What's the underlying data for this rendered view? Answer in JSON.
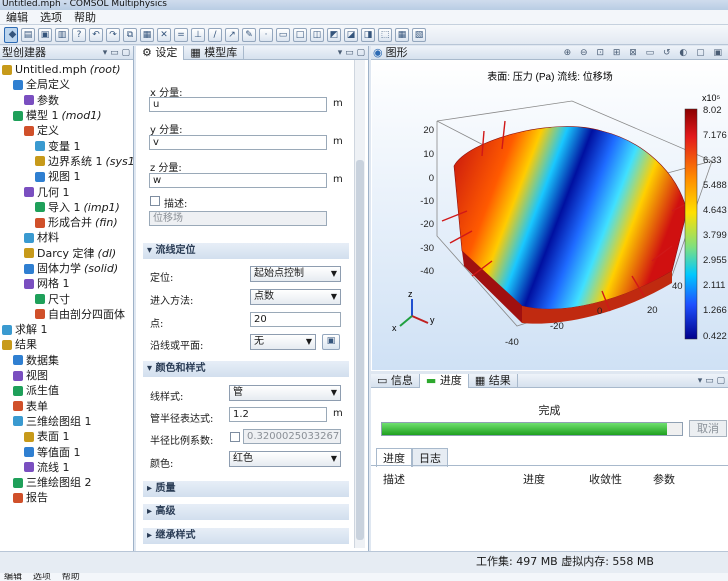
{
  "window": {
    "title": "Untitled.mph - COMSOL Multiphysics"
  },
  "menu": {
    "items": [
      "编辑",
      "选项",
      "帮助"
    ]
  },
  "model_builder": {
    "title": "型创建器",
    "tree": [
      {
        "label": "Untitled.mph",
        "suffix": "(root)",
        "indent": 0
      },
      {
        "label": "全局定义",
        "suffix": "",
        "indent": 1
      },
      {
        "label": "参数",
        "suffix": "",
        "indent": 2
      },
      {
        "label": "模型 1",
        "suffix": "(mod1)",
        "indent": 1
      },
      {
        "label": "定义",
        "suffix": "",
        "indent": 2
      },
      {
        "label": "变量 1",
        "suffix": "",
        "indent": 3
      },
      {
        "label": "边界系统 1",
        "suffix": "(sys1)",
        "indent": 3
      },
      {
        "label": "视图 1",
        "suffix": "",
        "indent": 3
      },
      {
        "label": "几何 1",
        "suffix": "",
        "indent": 2
      },
      {
        "label": "导入 1",
        "suffix": "(imp1)",
        "indent": 3
      },
      {
        "label": "形成合并",
        "suffix": "(fin)",
        "indent": 3
      },
      {
        "label": "材料",
        "suffix": "",
        "indent": 2
      },
      {
        "label": "Darcy 定律",
        "suffix": "(dl)",
        "indent": 2
      },
      {
        "label": "固体力学",
        "suffix": "(solid)",
        "indent": 2
      },
      {
        "label": "网格 1",
        "suffix": "",
        "indent": 2
      },
      {
        "label": "尺寸",
        "suffix": "",
        "indent": 3
      },
      {
        "label": "自由剖分四面体",
        "suffix": "",
        "indent": 3
      },
      {
        "label": "求解 1",
        "suffix": "",
        "indent": 0
      },
      {
        "label": "结果",
        "suffix": "",
        "indent": 0
      },
      {
        "label": "数据集",
        "suffix": "",
        "indent": 1
      },
      {
        "label": "视图",
        "suffix": "",
        "indent": 1
      },
      {
        "label": "派生值",
        "suffix": "",
        "indent": 1
      },
      {
        "label": "表单",
        "suffix": "",
        "indent": 1
      },
      {
        "label": "三维绘图组 1",
        "suffix": "",
        "indent": 1
      },
      {
        "label": "表面 1",
        "suffix": "",
        "indent": 2
      },
      {
        "label": "等值面 1",
        "suffix": "",
        "indent": 2
      },
      {
        "label": "流线 1",
        "suffix": "",
        "indent": 2
      },
      {
        "label": "三维绘图组 2",
        "suffix": "",
        "indent": 1
      },
      {
        "label": "报告",
        "suffix": "",
        "indent": 1
      }
    ]
  },
  "settings": {
    "tab_settings": "设定",
    "tab_library": "模型库",
    "x_label": "x 分量:",
    "x_value": "u",
    "y_label": "y 分量:",
    "y_value": "v",
    "z_label": "z 分量:",
    "z_value": "w",
    "unit_m": "m",
    "describe_label": "描述:",
    "describe_value": "位移场",
    "sec_streamline": "流线定位",
    "position_label": "定位:",
    "position_value": "起始点控制",
    "entry_label": "进入方法:",
    "entry_value": "点数",
    "points_label": "点:",
    "points_value": "20",
    "along_label": "沿线或平面:",
    "along_value": "无",
    "sec_color": "颜色和样式",
    "linestyle_label": "线样式:",
    "linestyle_value": "管",
    "tube_label": "管半径表达式:",
    "tube_value": "1.2",
    "ratio_label": "半径比例系数:",
    "ratio_value": "0.32000250332675",
    "color_label": "颜色:",
    "color_value": "红色",
    "sec_quality": "质量",
    "sec_advanced": "高级",
    "sec_inherit": "继承样式"
  },
  "graphics": {
    "title": "图形",
    "plot_title": "表面: 压力 (Pa)  流线: 位移场",
    "colorbar_exp": "x10⁵",
    "colorbar_ticks": [
      "8.02",
      "7.176",
      "6.33",
      "5.488",
      "4.643",
      "3.799",
      "2.955",
      "2.111",
      "1.266",
      "0.422"
    ],
    "axis_ticks_left": [
      "20",
      "10",
      "0",
      "-10",
      "-20",
      "-30",
      "-40"
    ],
    "axis_ticks_right": [
      "40",
      "20"
    ],
    "axis_ticks_bottom": [
      "-40",
      "-20",
      "0"
    ],
    "axis_labels": [
      "x",
      "y",
      "z"
    ]
  },
  "bottom": {
    "tab_info": "信息",
    "tab_progress": "进度",
    "tab_results": "结果",
    "status_text": "完成",
    "cancel": "取消",
    "progress": 0.95,
    "subtab_progress": "进度",
    "subtab_log": "日志",
    "col_desc": "描述",
    "col_progress": "进度",
    "col_convergence": "收敛性",
    "col_param": "参数"
  },
  "status": {
    "text": "工作集: 497 MB 虚拟内存: 558 MB"
  }
}
